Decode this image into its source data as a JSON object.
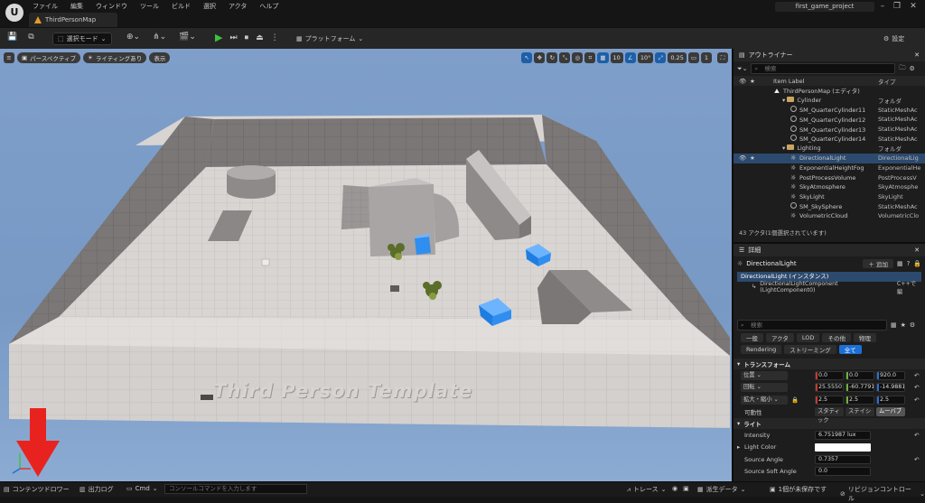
{
  "app": {
    "logo": "U",
    "menus": [
      "ファイル",
      "編集",
      "ウィンドウ",
      "ツール",
      "ビルド",
      "選択",
      "アクタ",
      "ヘルプ"
    ],
    "tab_title": "ThirdPersonMap",
    "project_name": "first_game_project"
  },
  "toolbar": {
    "select_mode": "選択モード",
    "platform": "プラットフォーム",
    "settings": "設定"
  },
  "viewport": {
    "perspective": "パースペクティブ",
    "lighting": "ライティングあり",
    "show": "表示",
    "grid_snap": "10",
    "rot_snap": "10°",
    "scale_snap": "0.25",
    "cam_speed": "1",
    "template_text": "Third Person Template"
  },
  "outliner": {
    "tab": "アウトライナー",
    "search_placeholder": "検索",
    "col_label": "Item Label",
    "col_type": "タイプ",
    "rows": [
      {
        "label": "ThirdPersonMap (エディタ)",
        "type": "",
        "kind": "map",
        "indent": 1
      },
      {
        "label": "Cylinder",
        "type": "フォルダ",
        "kind": "folder",
        "indent": 2
      },
      {
        "label": "SM_QuarterCylinder11",
        "type": "StaticMeshAc",
        "kind": "mesh",
        "indent": 3
      },
      {
        "label": "SM_QuarterCylinder12",
        "type": "StaticMeshAc",
        "kind": "mesh",
        "indent": 3
      },
      {
        "label": "SM_QuarterCylinder13",
        "type": "StaticMeshAc",
        "kind": "mesh",
        "indent": 3
      },
      {
        "label": "SM_QuarterCylinder14",
        "type": "StaticMeshAc",
        "kind": "mesh",
        "indent": 3
      },
      {
        "label": "Lighting",
        "type": "フォルダ",
        "kind": "folder",
        "indent": 2
      },
      {
        "label": "DirectionalLight",
        "type": "DirectionalLig",
        "kind": "light",
        "indent": 3,
        "selected": true
      },
      {
        "label": "ExponentialHeightFog",
        "type": "ExponentialHe",
        "kind": "light",
        "indent": 3
      },
      {
        "label": "PostProcessVolume",
        "type": "PostProcessV",
        "kind": "light",
        "indent": 3
      },
      {
        "label": "SkyAtmosphere",
        "type": "SkyAtmosphe",
        "kind": "light",
        "indent": 3
      },
      {
        "label": "SkyLight",
        "type": "SkyLight",
        "kind": "light",
        "indent": 3
      },
      {
        "label": "SM_SkySphere",
        "type": "StaticMeshAc",
        "kind": "mesh",
        "indent": 3
      },
      {
        "label": "VolumetricCloud",
        "type": "VolumetricClo",
        "kind": "light",
        "indent": 3
      }
    ],
    "footer": "43 アクタ(1個選択されています)"
  },
  "details": {
    "tab": "詳細",
    "actor_name": "DirectionalLight",
    "add_label": "追加",
    "instance_label": "DirectionalLight (インスタンス)",
    "component_label": "DirectionalLightComponent (LightComponent0)",
    "cpp_label": "C++で編",
    "search_placeholder": "検索",
    "filters_row1": [
      "一般",
      "アクタ",
      "LOD",
      "その他",
      "物理"
    ],
    "filters_row2": [
      "Rendering",
      "ストリーミング",
      "全て"
    ],
    "transform_section": "トランスフォーム",
    "location_label": "位置",
    "rotation_label": "回転",
    "scale_label": "拡大・縮小",
    "mobility_label": "可動性",
    "location": [
      "0.0",
      "0.0",
      "920.0"
    ],
    "rotation": [
      "25.55501",
      "-60.7791",
      "-14.9881"
    ],
    "scale": [
      "2.5",
      "2.5",
      "2.5"
    ],
    "mobility": [
      "スタティック",
      "ステイショ",
      "ムーバブ"
    ],
    "light_section": "ライト",
    "intensity_label": "Intensity",
    "intensity": "6.751987 lux",
    "light_color_label": "Light Color",
    "light_color": "#ffffff",
    "source_angle_label": "Source Angle",
    "source_angle": "0.7357",
    "source_soft_angle_label": "Source Soft Angle",
    "source_soft_angle": "0.0"
  },
  "statusbar": {
    "content_drawer": "コンテンツドロワー",
    "output_log": "出力ログ",
    "cmd": "Cmd",
    "cmd_placeholder": "コンソールコマンドを入力します",
    "trace": "トレース",
    "derived_data": "派生データ",
    "unsaved": "1個が未保存です",
    "revision_control": "リビジョンコントロール"
  },
  "colors": {
    "accent_blue": "#1d6fd6",
    "selection": "#2c4a6e",
    "play_green": "#3ec23e",
    "annotation_arrow": "#e8231f",
    "cube_blue": "#2f8ef0"
  }
}
